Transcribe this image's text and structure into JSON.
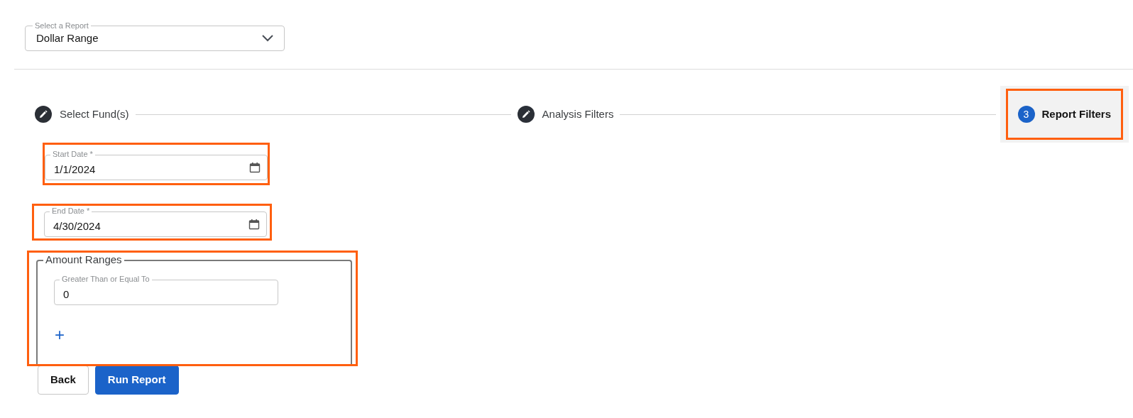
{
  "report_select": {
    "label": "Select a Report",
    "value": "Dollar Range"
  },
  "steps": [
    {
      "kind": "done",
      "label": "Select Fund(s)",
      "highlighted": false
    },
    {
      "kind": "done",
      "label": "Analysis Filters",
      "highlighted": false
    },
    {
      "kind": "current",
      "number": "3",
      "label": "Report Filters",
      "highlighted": true
    }
  ],
  "date_fields": [
    {
      "label": "Start Date *",
      "value": "1/1/2024",
      "highlighted": true
    },
    {
      "label": "End Date *",
      "value": "4/30/2024",
      "highlighted": true
    }
  ],
  "amount_ranges": {
    "legend": "Amount Ranges",
    "highlighted": true,
    "fields": [
      {
        "label": "Greater Than or Equal To",
        "value": "0"
      }
    ],
    "add_button": "+"
  },
  "buttons": [
    {
      "kind": "secondary",
      "label": "Back"
    },
    {
      "kind": "primary",
      "label": "Run Report"
    }
  ]
}
